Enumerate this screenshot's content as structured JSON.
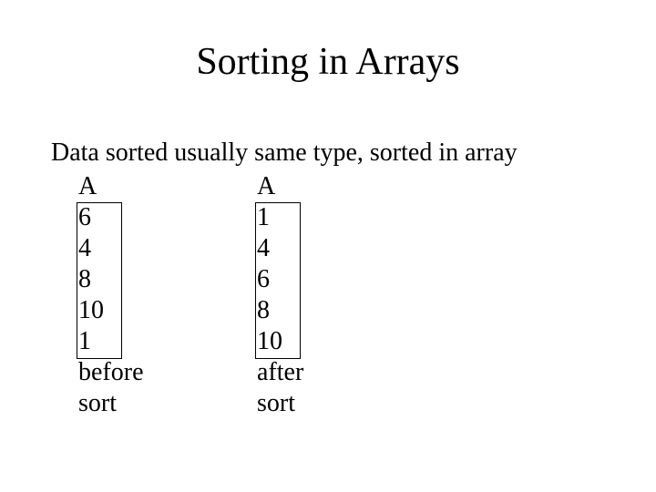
{
  "title": "Sorting in Arrays",
  "subtitle": "Data sorted usually same type, sorted in array",
  "left": {
    "label": "A",
    "v0": "6",
    "v1": "4",
    "v2": "8",
    "v3": "10",
    "v4": "1",
    "cap1": "before",
    "cap2": "sort"
  },
  "right": {
    "label": "A",
    "v0": "1",
    "v1": "4",
    "v2": "6",
    "v3": "8",
    "v4": "10",
    "cap1": "after",
    "cap2": "sort"
  }
}
